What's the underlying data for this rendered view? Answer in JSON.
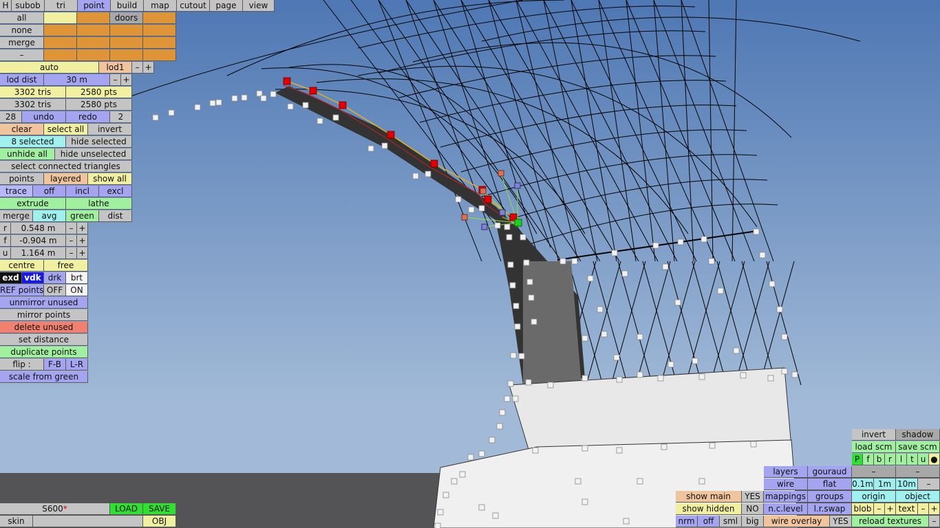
{
  "colors": {
    "sky_top": "#4e77b3",
    "sky_bottom": "#a2bad7",
    "ground": "#545456",
    "selected_point": "#e00000",
    "green_point": "#20d020"
  },
  "top_tabs": [
    "H",
    "subob",
    "tri",
    "point",
    "build",
    "map",
    "cutout",
    "page",
    "view"
  ],
  "left": {
    "all": "all",
    "doors": "doors",
    "none": "none",
    "merge_sel": "merge",
    "minus": "–",
    "auto": "auto",
    "lod1": "lod1",
    "dec": "–",
    "inc": "+",
    "lod_dist": "lod dist",
    "lod_value": "30 m",
    "tris1": "3302 tris",
    "pts1": "2580 pts",
    "tris2": "3302 tris",
    "pts2": "2580 pts",
    "undo_count": "28",
    "undo": "undo",
    "redo": "redo",
    "redo_count": "2",
    "clear": "clear",
    "select_all": "select all",
    "invert": "invert",
    "selected": "8 selected",
    "hide_selected": "hide selected",
    "unhide_all": "unhide all",
    "hide_unselected": "hide unselected",
    "select_connected": "select connected triangles",
    "points": "points",
    "layered": "layered",
    "show_all": "show all",
    "trace": "trace",
    "off": "off",
    "incl": "incl",
    "excl": "excl",
    "extrude": "extrude",
    "lathe": "lathe",
    "merge": "merge",
    "avg": "avg",
    "green": "green",
    "dist": "dist",
    "r_label": "r",
    "r_value": "0.548 m",
    "f_label": "f",
    "f_value": "-0.904 m",
    "u_label": "u",
    "u_value": "1.164 m",
    "centre": "centre",
    "free": "free",
    "exd": "exd",
    "vdk": "vdk",
    "drk": "drk",
    "brt": "brt",
    "ref_points": "REF points",
    "ref_off": "OFF",
    "ref_on": "ON",
    "unmirror": "unmirror unused",
    "mirror": "mirror points",
    "delete_unused": "delete unused",
    "set_distance": "set distance",
    "duplicate": "duplicate points",
    "flip": "flip :",
    "fb": "F-B",
    "lr": "L-R",
    "scale_green": "scale from green"
  },
  "bottom_left": {
    "model": "S600",
    "modified_mark": "*",
    "load": "LOAD",
    "save": "SAVE",
    "skin": "skin",
    "obj": "OBJ"
  },
  "bottom_right": {
    "show_main": "show main",
    "show_main_val": "YES",
    "show_hidden": "show hidden",
    "show_hidden_val": "NO",
    "nrm": "nrm",
    "off": "off",
    "sml": "sml",
    "big": "big",
    "layers": "layers",
    "gouraud": "gouraud",
    "wire": "wire",
    "flat": "flat",
    "mappings": "mappings",
    "groups": "groups",
    "nclevel": "n.c.level",
    "lrswap": "l.r.swap",
    "wire_overlay": "wire overlay",
    "wire_overlay_val": "YES",
    "invert": "invert",
    "shadow": "shadow",
    "load_scm": "load scm",
    "save_scm": "save scm",
    "letters": [
      "P",
      "f",
      "b",
      "r",
      "l",
      "t",
      "u",
      "●"
    ],
    "dash": "–",
    "d01": "0.1m",
    "d1": "1m",
    "d10": "10m",
    "origin": "origin",
    "object": "object",
    "blob": "blob",
    "text": "text",
    "plus": "+",
    "minus": "–",
    "reload": "reload textures"
  }
}
